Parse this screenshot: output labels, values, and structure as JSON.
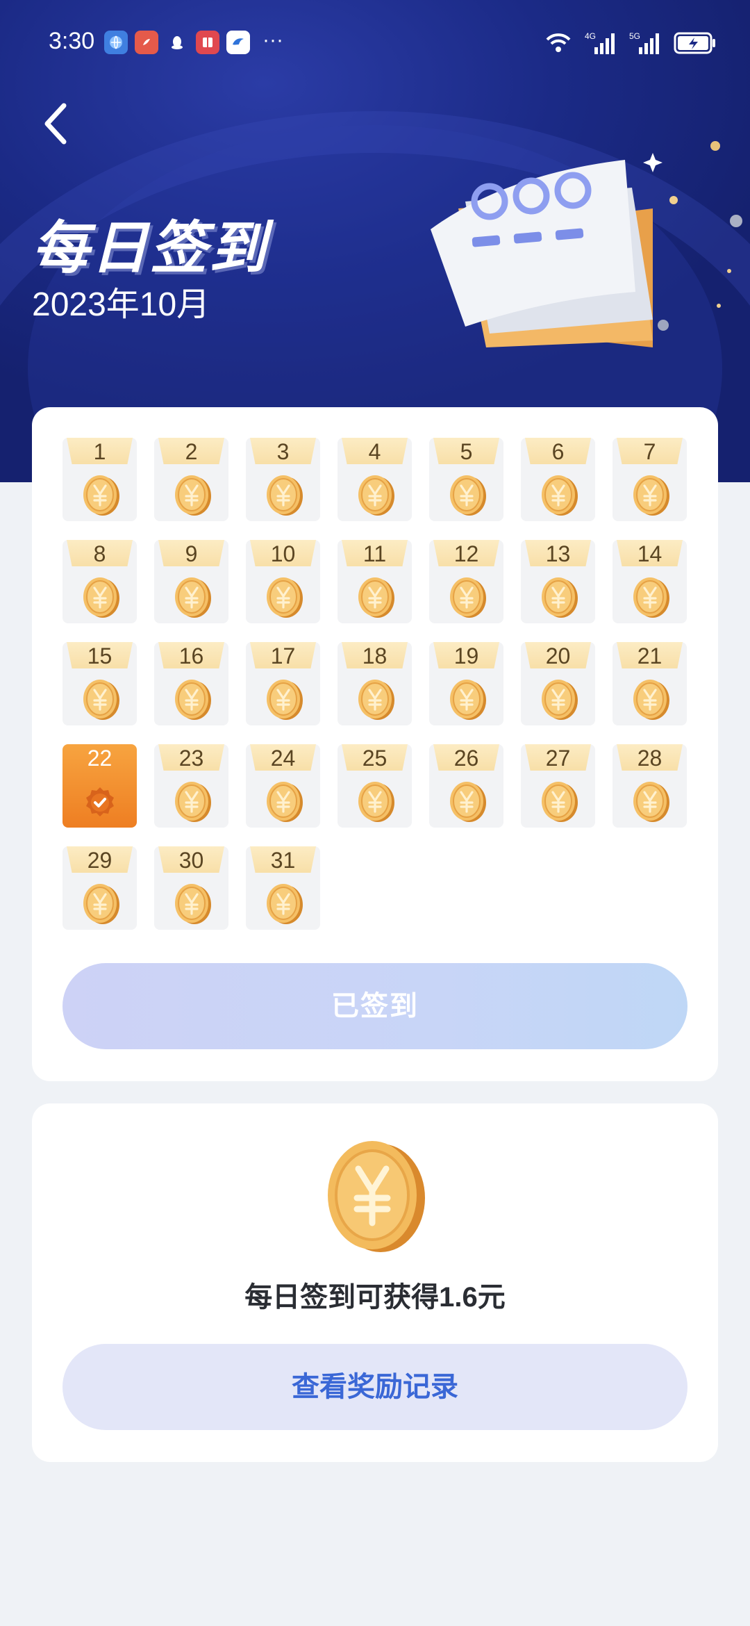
{
  "status_bar": {
    "time": "3:30",
    "apps": [
      "browser-icon",
      "app-icon",
      "qq-icon",
      "book-icon",
      "bird-icon"
    ],
    "more": "···",
    "net1": "4G",
    "net2": "5G"
  },
  "header": {
    "title": "每日签到",
    "subtitle": "2023年10月"
  },
  "calendar": {
    "signed_day": 22,
    "days": [
      "1",
      "2",
      "3",
      "4",
      "5",
      "6",
      "7",
      "8",
      "9",
      "10",
      "11",
      "12",
      "13",
      "14",
      "15",
      "16",
      "17",
      "18",
      "19",
      "20",
      "21",
      "22",
      "23",
      "24",
      "25",
      "26",
      "27",
      "28",
      "29",
      "30",
      "31"
    ]
  },
  "signed_button": "已签到",
  "reward": {
    "text": "每日签到可获得1.6元",
    "record_button": "查看奖励记录"
  },
  "colors": {
    "hero": "#1b2a86",
    "signed_day": "#ee7e22",
    "coin": "#f0b04a",
    "link": "#3a67d6"
  }
}
